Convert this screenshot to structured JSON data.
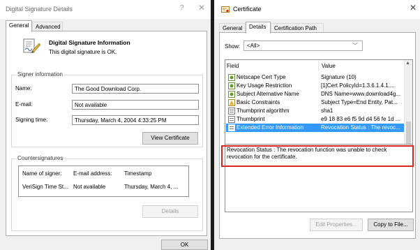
{
  "left_window": {
    "title": "Digital Signature Details",
    "help_glyph": "?",
    "close_glyph": "✕",
    "tabs": [
      {
        "label": "General",
        "active": true
      },
      {
        "label": "Advanced",
        "active": false
      }
    ],
    "header": {
      "icon": "signature-document-icon",
      "title": "Digital Signature Information",
      "status": "This digital signature is OK."
    },
    "signer": {
      "legend": "Signer information",
      "name_label": "Name:",
      "name_value": "The Good Download Corp.",
      "email_label": "E-mail:",
      "email_value": "Not available",
      "time_label": "Signing time:",
      "time_value": "Thursday, March 4, 2004 4:33:25 PM",
      "view_cert_button": "View Certificate"
    },
    "countersignatures": {
      "legend": "Countersignatures",
      "columns": [
        "Name of signer:",
        "E-mail address:",
        "Timestamp"
      ],
      "rows": [
        [
          "VeriSign Time St...",
          "Not available",
          "Thursday, March 4, ..."
        ]
      ],
      "details_button": "Details"
    },
    "ok_button": "OK"
  },
  "right_window": {
    "title": "Certificate",
    "title_icon": "certificate-icon",
    "close_glyph": "✕",
    "tabs": [
      {
        "label": "General",
        "active": false
      },
      {
        "label": "Details",
        "active": true
      },
      {
        "label": "Certification Path",
        "active": false
      }
    ],
    "show_label": "Show:",
    "show_value": "<All>",
    "columns": {
      "field": "Field",
      "value": "Value"
    },
    "rows": [
      {
        "icon": "extension-icon",
        "field": "Netscape Cert Type",
        "value": "Signature (10)",
        "selected": false
      },
      {
        "icon": "extension-icon",
        "field": "Key Usage Restriction",
        "value": "[1]Cert PolicyId=1.3.6.1.4.1....",
        "selected": false
      },
      {
        "icon": "extension-icon",
        "field": "Subject Alternative Name",
        "value": "DNS Name=www.download4g...",
        "selected": false
      },
      {
        "icon": "critical-extension-icon",
        "field": "Basic Constraints",
        "value": "Subject Type=End Entity, Pat...",
        "selected": false
      },
      {
        "icon": "property-icon",
        "field": "Thumbprint algorithm",
        "value": "sha1",
        "selected": false
      },
      {
        "icon": "property-icon",
        "field": "Thumbprint",
        "value": "e9 18 83 e6 f5 9d d4 56 fe 1d ...",
        "selected": false
      },
      {
        "icon": "property-icon",
        "field": "Extended Error Information",
        "value": "Revocation Status : The revoc...",
        "selected": true
      }
    ],
    "value_detail": "Revocation Status : The revocation function was unable to check revocation for the certificate.",
    "edit_properties_button": "Edit Properties...",
    "copy_to_file_button": "Copy to File..."
  },
  "colors": {
    "selection": "#3399ff",
    "highlight": "#d9271f",
    "window_bg": "#f0f0f0",
    "divider": "#1b1b1b"
  }
}
